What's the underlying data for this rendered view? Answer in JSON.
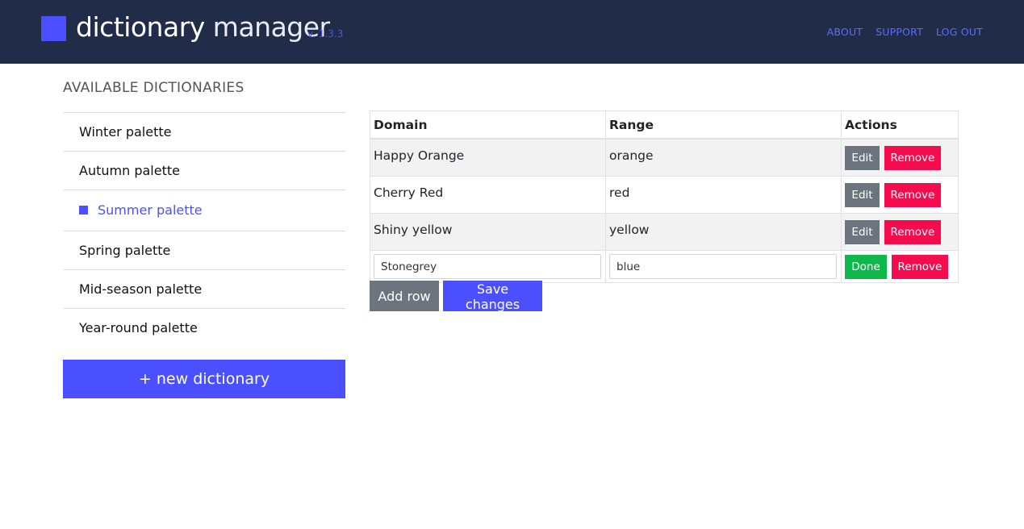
{
  "app": {
    "title_word1": "dictionary",
    "title_word2": "manager",
    "version": "v. 1.3.3",
    "brand_color": "#4b50ff",
    "nav_bg": "#212c49"
  },
  "nav": {
    "about": "ABOUT",
    "support": "SUPPORT",
    "logout": "LOG OUT"
  },
  "sidebar": {
    "title": "AVAILABLE DICTIONARIES",
    "items": [
      {
        "label": "Winter palette",
        "active": false
      },
      {
        "label": "Autumn palette",
        "active": false
      },
      {
        "label": "Summer palette",
        "active": true
      },
      {
        "label": "Spring palette",
        "active": false
      },
      {
        "label": "Mid-season palette",
        "active": false
      },
      {
        "label": "Year-round palette",
        "active": false
      }
    ],
    "new_button": "+ new dictionary"
  },
  "table": {
    "headers": {
      "domain": "Domain",
      "range": "Range",
      "actions": "Actions"
    },
    "rows": [
      {
        "domain": "Happy Orange",
        "range": "orange"
      },
      {
        "domain": "Cherry Red",
        "range": "red"
      },
      {
        "domain": "Shiny yellow",
        "range": "yellow"
      }
    ],
    "editing_row": {
      "domain": "Stonegrey",
      "range": "blue"
    },
    "edit_label": "Edit",
    "remove_label": "Remove",
    "done_label": "Done"
  },
  "actions": {
    "add_row": "Add row",
    "save": "Save changes"
  }
}
